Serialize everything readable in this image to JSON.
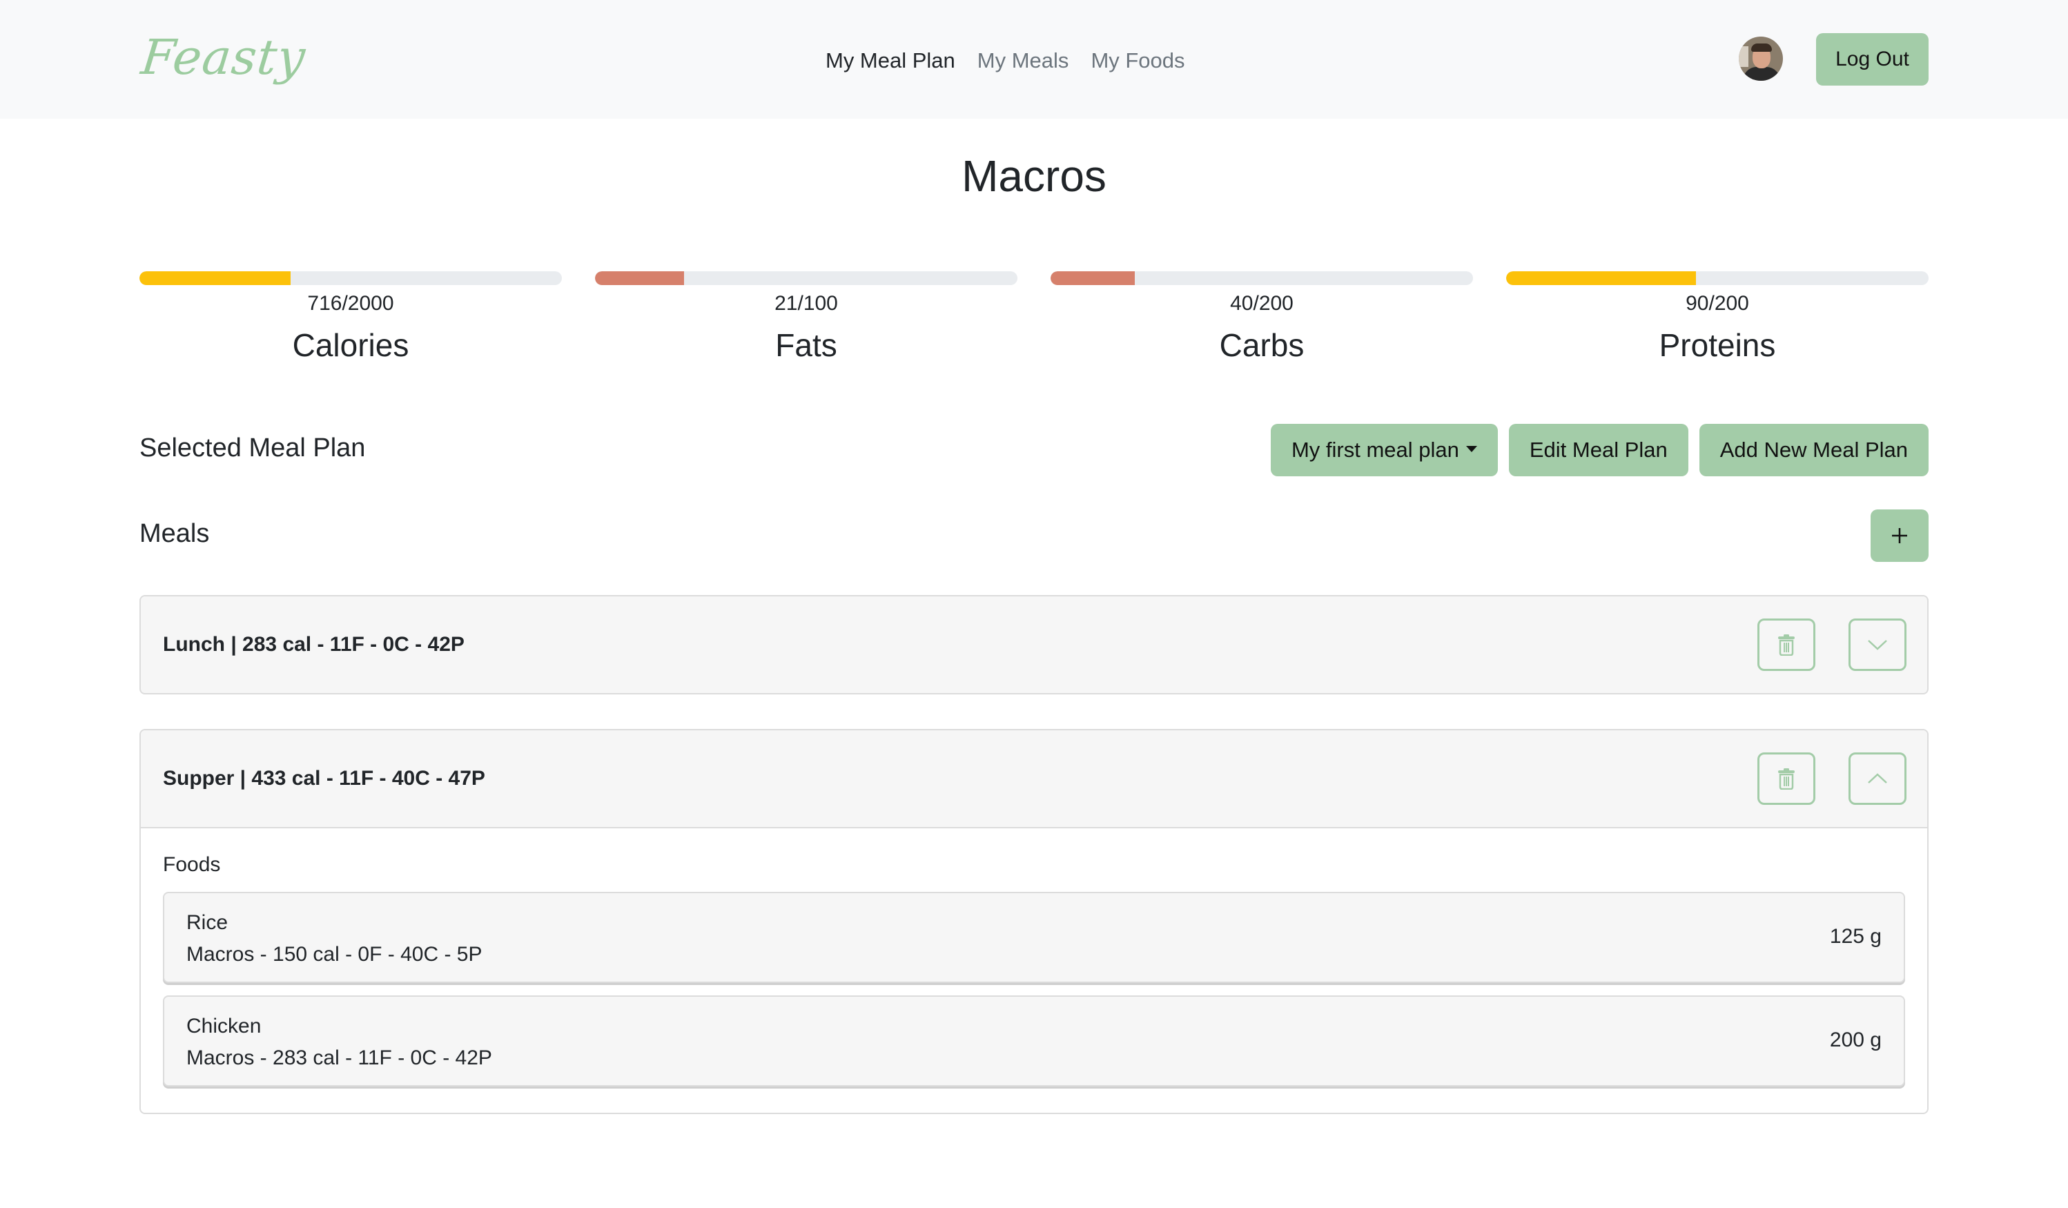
{
  "app": {
    "logo": "Feasty",
    "nav": [
      {
        "label": "My Meal Plan",
        "active": true
      },
      {
        "label": "My Meals",
        "active": false
      },
      {
        "label": "My Foods",
        "active": false
      }
    ],
    "logout_label": "Log Out",
    "avatar_alt": "user-avatar"
  },
  "page_title": "Macros",
  "macros": [
    {
      "label": "Calories",
      "value_text": "716/2000",
      "current": 716,
      "goal": 2000,
      "color": "#fcc10a"
    },
    {
      "label": "Fats",
      "value_text": "21/100",
      "current": 21,
      "goal": 100,
      "color": "#d6806b"
    },
    {
      "label": "Carbs",
      "value_text": "40/200",
      "current": 40,
      "goal": 200,
      "color": "#d6806b"
    },
    {
      "label": "Proteins",
      "value_text": "90/200",
      "current": 90,
      "goal": 200,
      "color": "#fcc10a"
    }
  ],
  "meal_plan": {
    "label": "Selected Meal Plan",
    "selected": "My first meal plan",
    "edit_label": "Edit Meal Plan",
    "add_label": "Add New Meal Plan"
  },
  "meals_section": {
    "label": "Meals",
    "add_label": "+"
  },
  "meals": [
    {
      "title": "Lunch | 283 cal - 11F - 0C - 42P",
      "expanded": false
    },
    {
      "title": "Supper | 433 cal - 11F - 40C - 47P",
      "expanded": true,
      "foods_label": "Foods",
      "foods": [
        {
          "name": "Rice",
          "macros": "Macros - 150 cal - 0F - 40C - 5P",
          "quantity": "125 g"
        },
        {
          "name": "Chicken",
          "macros": "Macros - 283 cal - 11F - 0C - 42P",
          "quantity": "200 g"
        }
      ]
    }
  ],
  "colors": {
    "accent_green": "#a3cca8",
    "logo_green": "#9ccc9f",
    "progress_yellow": "#fcc10a",
    "progress_salmon": "#d6806b",
    "track": "#e9ecef"
  }
}
